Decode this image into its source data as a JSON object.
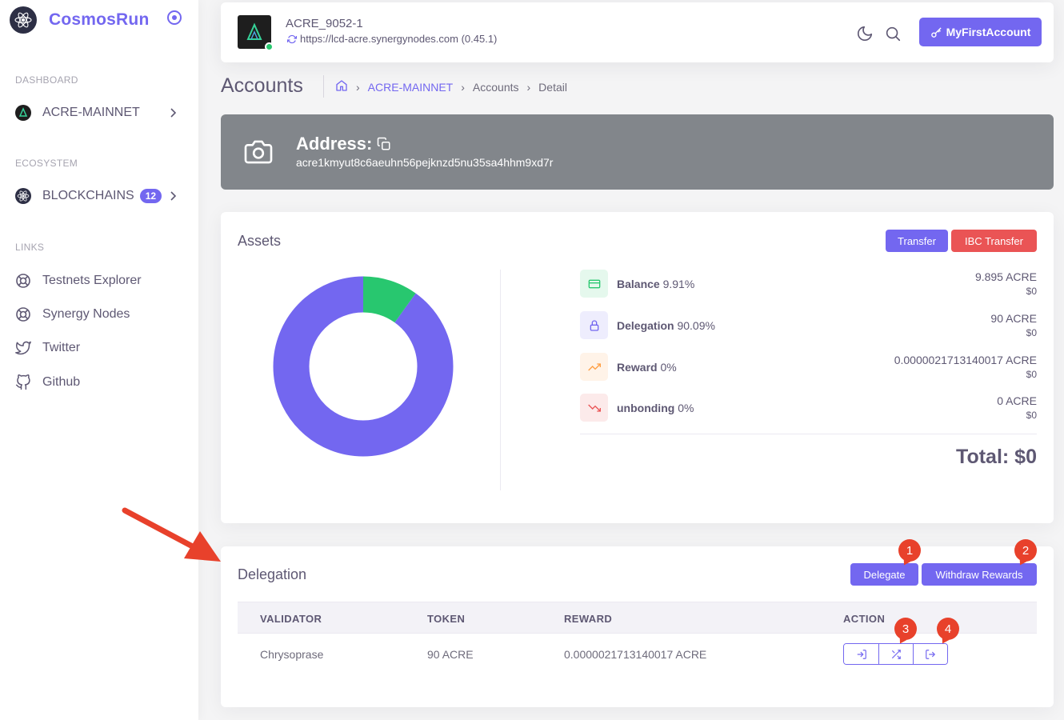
{
  "sidebar": {
    "brand": "CosmosRun",
    "sections": {
      "dashboard": "DASHBOARD",
      "ecosystem": "ECOSYSTEM",
      "links": "LINKS"
    },
    "items": [
      {
        "label": "ACRE-MAINNET"
      },
      {
        "label": "BLOCKCHAINS",
        "badge": "12"
      },
      {
        "label": "Testnets Explorer"
      },
      {
        "label": "Synergy Nodes"
      },
      {
        "label": "Twitter"
      },
      {
        "label": "Github"
      }
    ]
  },
  "navbar": {
    "chain_id": "ACRE_9052-1",
    "endpoint": "https://lcd-acre.synergynodes.com (0.45.1)",
    "account_button": "MyFirstAccount"
  },
  "page": {
    "title": "Accounts",
    "breadcrumb": [
      "ACRE-MAINNET",
      "Accounts",
      "Detail"
    ]
  },
  "address": {
    "label": "Address:",
    "value": "acre1kmyut8c6aeuhn56pejknzd5nu35sa4hhm9xd7r"
  },
  "assets": {
    "title": "Assets",
    "transfer_button": "Transfer",
    "ibc_transfer_button": "IBC Transfer",
    "rows": [
      {
        "name": "Balance",
        "percent": "9.91%",
        "amount": "9.895 ACRE",
        "value": "$0",
        "color": "#28c76f"
      },
      {
        "name": "Delegation",
        "percent": "90.09%",
        "amount": "90 ACRE",
        "value": "$0",
        "color": "#7367f0"
      },
      {
        "name": "Reward",
        "percent": "0%",
        "amount": "0.0000021713140017 ACRE",
        "value": "$0",
        "color": "#ff9f43"
      },
      {
        "name": "unbonding",
        "percent": "0%",
        "amount": "0 ACRE",
        "value": "$0",
        "color": "#ea5455"
      }
    ],
    "total": "Total: $0",
    "donut": {
      "balance_fraction": 0.0991,
      "delegation_fraction": 0.9009
    }
  },
  "delegation": {
    "title": "Delegation",
    "delegate_button": "Delegate",
    "withdraw_button": "Withdraw Rewards",
    "columns": [
      "VALIDATOR",
      "TOKEN",
      "REWARD",
      "ACTION"
    ],
    "rows": [
      {
        "validator": "Chrysoprase",
        "token": "90 ACRE",
        "reward": "0.0000021713140017 ACRE"
      }
    ]
  },
  "annotations": [
    "1",
    "2",
    "3",
    "4"
  ],
  "colors": {
    "accent": "#7367f0",
    "danger": "#ea5455",
    "success": "#28c76f",
    "warning": "#ff9f43",
    "annotation": "#e8412b"
  }
}
